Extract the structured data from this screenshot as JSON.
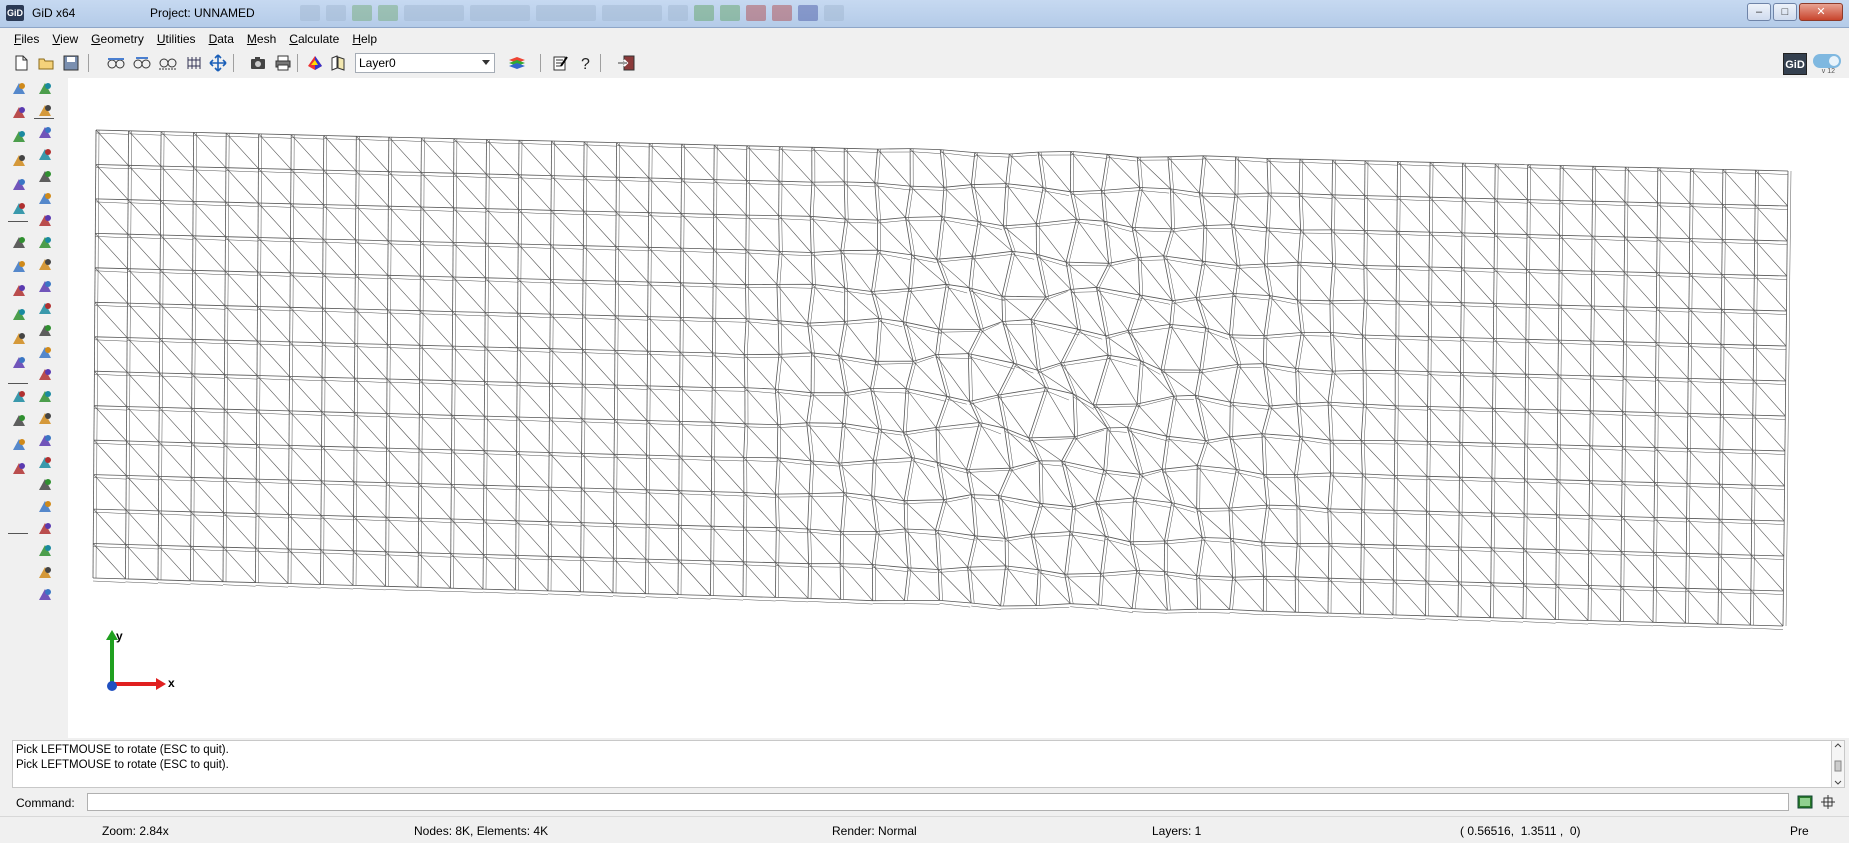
{
  "window": {
    "app_name": "GiD x64",
    "logo_text": "GiD",
    "project_title": "Project: UNNAMED",
    "controls": [
      "minimize",
      "maximize",
      "close"
    ]
  },
  "menubar": {
    "items": [
      {
        "label": "Files",
        "underline": "F",
        "rest": "iles"
      },
      {
        "label": "View",
        "underline": "V",
        "rest": "iew"
      },
      {
        "label": "Geometry",
        "underline": "G",
        "rest": "eometry"
      },
      {
        "label": "Utilities",
        "underline": "U",
        "rest": "tilities"
      },
      {
        "label": "Data",
        "underline": "D",
        "rest": "ata"
      },
      {
        "label": "Mesh",
        "underline": "M",
        "rest": "esh"
      },
      {
        "label": "Calculate",
        "underline": "C",
        "rest": "alculate"
      },
      {
        "label": "Help",
        "underline": "H",
        "rest": "elp"
      }
    ]
  },
  "toolbar": {
    "buttons": [
      "new-file-icon",
      "open-folder-icon",
      "save-icon",
      "zoom-in-glasses-icon",
      "zoom-out-glasses-icon",
      "zoom-frame-glasses-icon",
      "mesh-grid-icon",
      "pan-arrows-icon",
      "camera-icon",
      "print-icon",
      "render-color-icon",
      "books-icon",
      "layers-stack-icon",
      "edit-notes-icon",
      "help-icon",
      "exit-icon"
    ],
    "layer_value": "Layer0",
    "gid_badge": "GiD",
    "version_badge": "v 12"
  },
  "left_toolbar": {
    "col1": [
      "zoom-in-icon",
      "zoom-out-icon",
      "zoom-frame-icon",
      "recycle-icon",
      "shape-color-icon",
      "point-pick-icon",
      "line-icon",
      "arc-icon",
      "circle-icon",
      "polyline-icon",
      "surface-icon",
      "volume-icon",
      "solid-shapes-icon",
      "eraser-icon",
      "list-icon",
      "mesh-surface-icon"
    ],
    "col2": [
      "point-icon",
      "edit-icon",
      "block-icon",
      "rectangle-icon",
      "label-icon",
      "layers-icon",
      "layers-stack-icon",
      "folder-open-icon",
      "folder-icon",
      "surface-mesh-icon",
      "surface-select-icon",
      "nurbs-icon",
      "curve-icon",
      "curve-join-icon",
      "curve-split-icon",
      "intersect-icon",
      "ladder-icon",
      "mesh-quad-icon",
      "mesh-tri-icon",
      "mesh-star-icon",
      "mesh-quality-icon",
      "node-icon",
      "boundary-icon",
      "draw-normals-icon"
    ]
  },
  "viewport": {
    "axes": {
      "x_label": "x",
      "y_label": "y"
    },
    "mesh": {
      "cols": 52,
      "rows": 13
    }
  },
  "console": {
    "lines": [
      "Pick LEFTMOUSE to rotate (ESC to quit).",
      "Pick LEFTMOUSE to rotate (ESC to quit)."
    ],
    "command_label": "Command:",
    "command_value": ""
  },
  "status": {
    "zoom": "Zoom: 2.84x",
    "nodes_elements": "Nodes: 8K, Elements: 4K",
    "render": "Render: Normal",
    "layers": "Layers: 1",
    "coords": "( 0.56516,  1.3511 ,  0)",
    "mode": "Pre"
  },
  "colors": {
    "titlebar": "#c6d9f1",
    "mesh_line": "#555555",
    "axis_x": "#e02020",
    "axis_y": "#20a020",
    "axis_z": "#2050c0"
  }
}
